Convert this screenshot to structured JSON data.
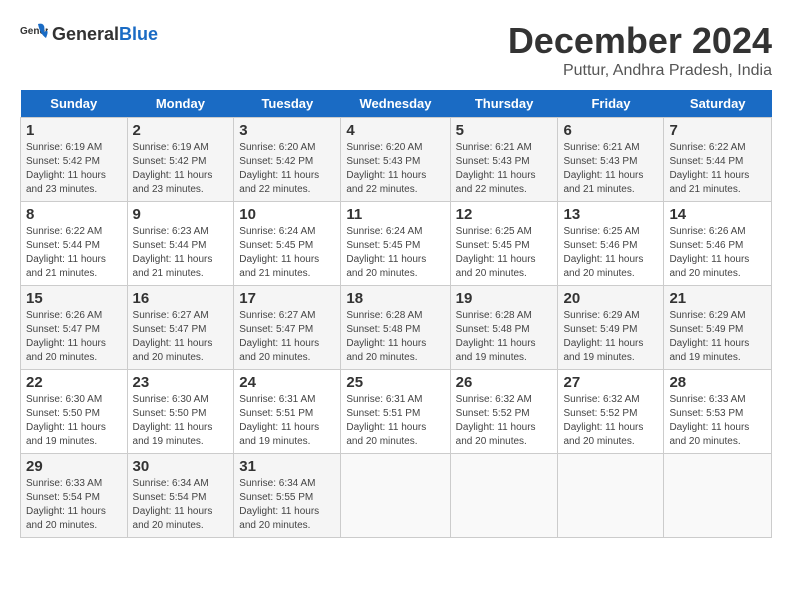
{
  "logo": {
    "general": "General",
    "blue": "Blue"
  },
  "title": "December 2024",
  "subtitle": "Puttur, Andhra Pradesh, India",
  "days_of_week": [
    "Sunday",
    "Monday",
    "Tuesday",
    "Wednesday",
    "Thursday",
    "Friday",
    "Saturday"
  ],
  "weeks": [
    [
      {
        "day": "1",
        "sunrise": "6:19 AM",
        "sunset": "5:42 PM",
        "daylight": "11 hours and 23 minutes."
      },
      {
        "day": "2",
        "sunrise": "6:19 AM",
        "sunset": "5:42 PM",
        "daylight": "11 hours and 23 minutes."
      },
      {
        "day": "3",
        "sunrise": "6:20 AM",
        "sunset": "5:42 PM",
        "daylight": "11 hours and 22 minutes."
      },
      {
        "day": "4",
        "sunrise": "6:20 AM",
        "sunset": "5:43 PM",
        "daylight": "11 hours and 22 minutes."
      },
      {
        "day": "5",
        "sunrise": "6:21 AM",
        "sunset": "5:43 PM",
        "daylight": "11 hours and 22 minutes."
      },
      {
        "day": "6",
        "sunrise": "6:21 AM",
        "sunset": "5:43 PM",
        "daylight": "11 hours and 21 minutes."
      },
      {
        "day": "7",
        "sunrise": "6:22 AM",
        "sunset": "5:44 PM",
        "daylight": "11 hours and 21 minutes."
      }
    ],
    [
      {
        "day": "8",
        "sunrise": "6:22 AM",
        "sunset": "5:44 PM",
        "daylight": "11 hours and 21 minutes."
      },
      {
        "day": "9",
        "sunrise": "6:23 AM",
        "sunset": "5:44 PM",
        "daylight": "11 hours and 21 minutes."
      },
      {
        "day": "10",
        "sunrise": "6:24 AM",
        "sunset": "5:45 PM",
        "daylight": "11 hours and 21 minutes."
      },
      {
        "day": "11",
        "sunrise": "6:24 AM",
        "sunset": "5:45 PM",
        "daylight": "11 hours and 20 minutes."
      },
      {
        "day": "12",
        "sunrise": "6:25 AM",
        "sunset": "5:45 PM",
        "daylight": "11 hours and 20 minutes."
      },
      {
        "day": "13",
        "sunrise": "6:25 AM",
        "sunset": "5:46 PM",
        "daylight": "11 hours and 20 minutes."
      },
      {
        "day": "14",
        "sunrise": "6:26 AM",
        "sunset": "5:46 PM",
        "daylight": "11 hours and 20 minutes."
      }
    ],
    [
      {
        "day": "15",
        "sunrise": "6:26 AM",
        "sunset": "5:47 PM",
        "daylight": "11 hours and 20 minutes."
      },
      {
        "day": "16",
        "sunrise": "6:27 AM",
        "sunset": "5:47 PM",
        "daylight": "11 hours and 20 minutes."
      },
      {
        "day": "17",
        "sunrise": "6:27 AM",
        "sunset": "5:47 PM",
        "daylight": "11 hours and 20 minutes."
      },
      {
        "day": "18",
        "sunrise": "6:28 AM",
        "sunset": "5:48 PM",
        "daylight": "11 hours and 20 minutes."
      },
      {
        "day": "19",
        "sunrise": "6:28 AM",
        "sunset": "5:48 PM",
        "daylight": "11 hours and 19 minutes."
      },
      {
        "day": "20",
        "sunrise": "6:29 AM",
        "sunset": "5:49 PM",
        "daylight": "11 hours and 19 minutes."
      },
      {
        "day": "21",
        "sunrise": "6:29 AM",
        "sunset": "5:49 PM",
        "daylight": "11 hours and 19 minutes."
      }
    ],
    [
      {
        "day": "22",
        "sunrise": "6:30 AM",
        "sunset": "5:50 PM",
        "daylight": "11 hours and 19 minutes."
      },
      {
        "day": "23",
        "sunrise": "6:30 AM",
        "sunset": "5:50 PM",
        "daylight": "11 hours and 19 minutes."
      },
      {
        "day": "24",
        "sunrise": "6:31 AM",
        "sunset": "5:51 PM",
        "daylight": "11 hours and 19 minutes."
      },
      {
        "day": "25",
        "sunrise": "6:31 AM",
        "sunset": "5:51 PM",
        "daylight": "11 hours and 20 minutes."
      },
      {
        "day": "26",
        "sunrise": "6:32 AM",
        "sunset": "5:52 PM",
        "daylight": "11 hours and 20 minutes."
      },
      {
        "day": "27",
        "sunrise": "6:32 AM",
        "sunset": "5:52 PM",
        "daylight": "11 hours and 20 minutes."
      },
      {
        "day": "28",
        "sunrise": "6:33 AM",
        "sunset": "5:53 PM",
        "daylight": "11 hours and 20 minutes."
      }
    ],
    [
      {
        "day": "29",
        "sunrise": "6:33 AM",
        "sunset": "5:54 PM",
        "daylight": "11 hours and 20 minutes."
      },
      {
        "day": "30",
        "sunrise": "6:34 AM",
        "sunset": "5:54 PM",
        "daylight": "11 hours and 20 minutes."
      },
      {
        "day": "31",
        "sunrise": "6:34 AM",
        "sunset": "5:55 PM",
        "daylight": "11 hours and 20 minutes."
      },
      null,
      null,
      null,
      null
    ]
  ]
}
